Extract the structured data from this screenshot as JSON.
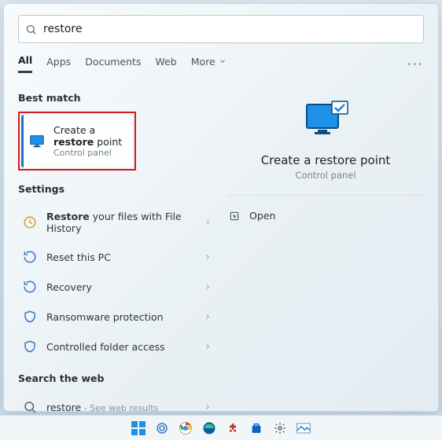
{
  "search": {
    "value": "restore"
  },
  "tabs": {
    "all": "All",
    "apps": "Apps",
    "documents": "Documents",
    "web": "Web",
    "more": "More"
  },
  "sections": {
    "bestmatch": "Best match",
    "settings": "Settings",
    "web": "Search the web"
  },
  "bestmatch": {
    "title_pre": "Create a ",
    "title_bold": "restore",
    "title_post": " point",
    "subtitle": "Control panel"
  },
  "settingsList": {
    "r0_pre": "Restore",
    "r0_post": " your files with File History",
    "r1": "Reset this PC",
    "r2": "Recovery",
    "r3": "Ransomware protection",
    "r4": "Controlled folder access"
  },
  "webrow": {
    "term": "restore",
    "suffix": " - See web results"
  },
  "card": {
    "title": "Create a restore point",
    "subtitle": "Control panel",
    "open": "Open"
  }
}
